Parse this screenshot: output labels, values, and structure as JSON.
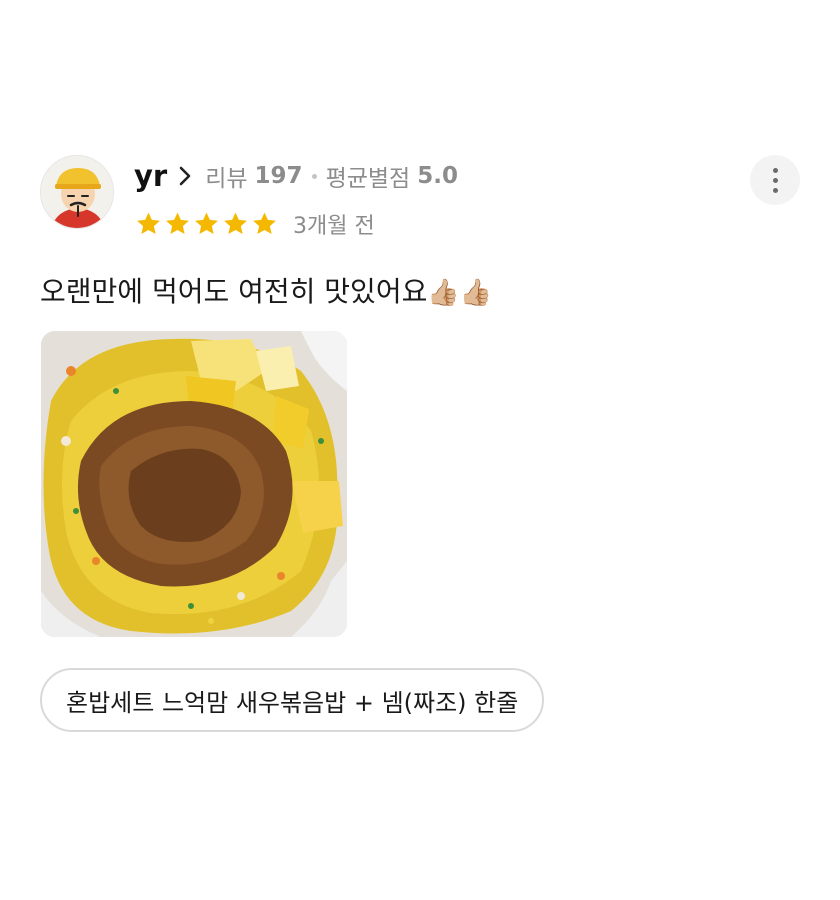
{
  "review": {
    "user": {
      "name": "yr",
      "review_label": "리뷰",
      "review_count": "197",
      "avg_label": "평균별점",
      "avg_rating": "5.0",
      "avatar_icon": "cartoon-avatar-icon"
    },
    "rating": 5,
    "time_ago": "3개월 전",
    "text": "오랜만에 먹어도 여전히 맛있어요",
    "emojis": "👍🏼👍🏼",
    "photo_icon": "fried-rice-photo",
    "menu_chip": "혼밥세트 느억맘 새우볶음밥 + 넴(짜조) 한줄"
  },
  "icons": {
    "chevron": "chevron-right-icon",
    "more": "more-vertical-icon",
    "star": "star-icon"
  },
  "colors": {
    "star": "#f5b800",
    "meta_text": "#8c8c8c",
    "chip_border": "#d9d9d9"
  }
}
